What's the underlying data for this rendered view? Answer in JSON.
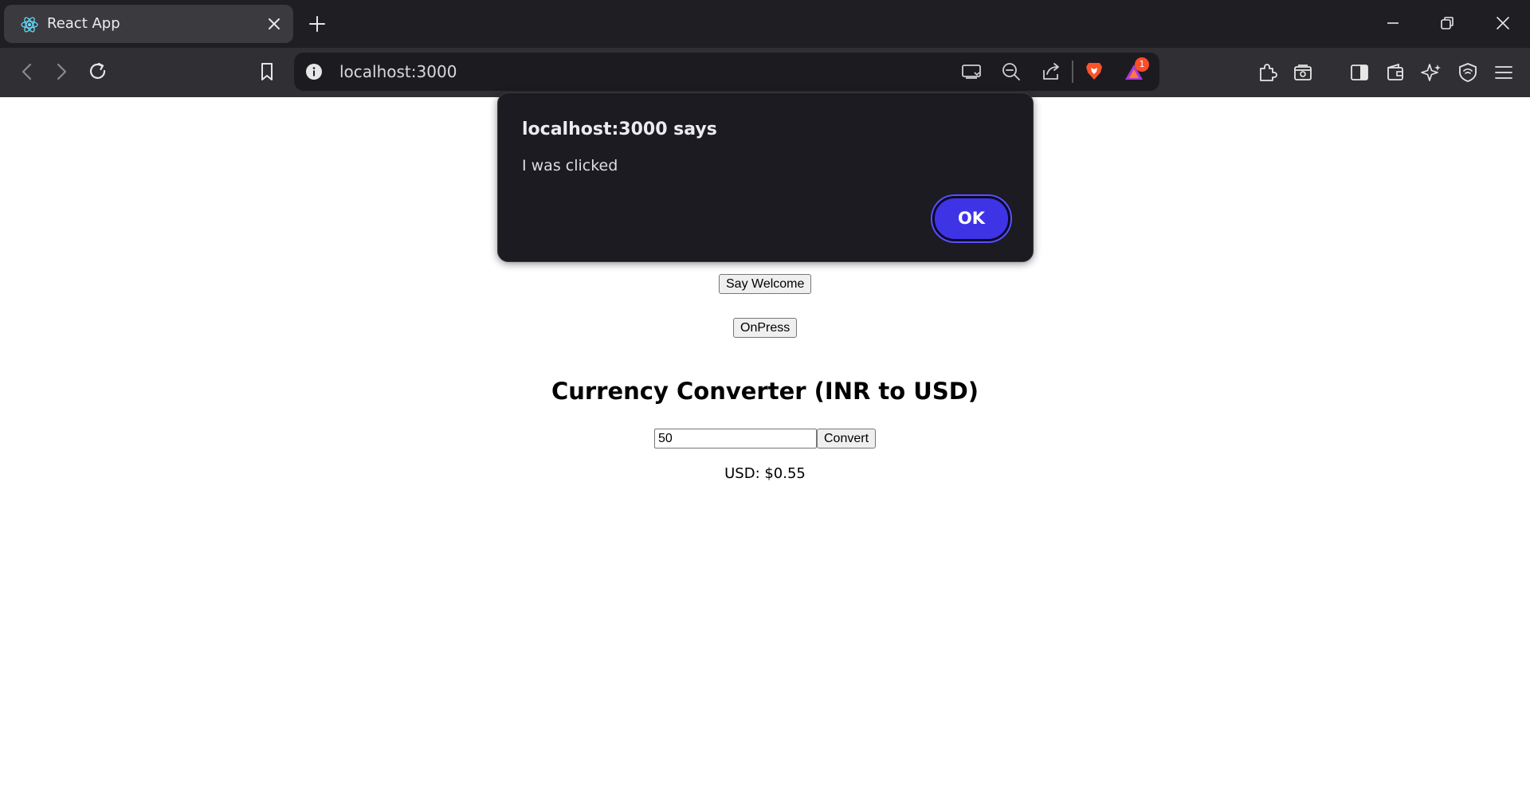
{
  "browser": {
    "tab": {
      "title": "React App"
    },
    "address_bar": {
      "url": "localhost:3000"
    },
    "notification_count": "1"
  },
  "page": {
    "buttons": {
      "say_welcome": "Say Welcome",
      "on_press": "OnPress",
      "convert": "Convert"
    },
    "converter": {
      "heading": "Currency Converter (INR to USD)",
      "input_value": "50",
      "result": "USD: $0.55"
    }
  },
  "dialog": {
    "title": "localhost:3000 says",
    "message": "I was clicked",
    "ok_label": "OK"
  },
  "icons": {
    "favicon": "react-icon",
    "accent": "#3f33e6"
  }
}
